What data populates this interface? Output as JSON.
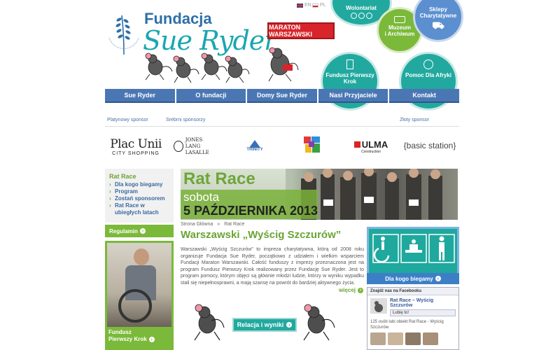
{
  "header": {
    "logo_line1": "Fundacja",
    "logo_line2": "Sue Ryder",
    "marathon_logo": "MARATON WARSZAWSKI",
    "lang_en": "EN",
    "lang_pl": "PL",
    "colors": {
      "blue": "#4a77b4",
      "green": "#7bb93a",
      "teal": "#22a99f"
    }
  },
  "circles": {
    "volunteer": "Wolontariat",
    "museum_line1": "Muzeum",
    "museum_line2": "i Archiwum",
    "shops_line1": "Sklepy",
    "shops_line2": "Charytatywne",
    "fund": "Fundusz Pierwszy Krok",
    "africa": "Pomoc Dla Afryki"
  },
  "nav": {
    "items": [
      "Sue Ryder",
      "O fundacji",
      "Domy Sue Ryder",
      "Nasi Przyjaciele",
      "Kontakt"
    ]
  },
  "sponsors": {
    "platinum_label": "Platynowy sponsor",
    "silver_label": "Srebrni sponsorzy",
    "gold_label": "Złoty sponsor",
    "logo1_line1": "Plac Unii",
    "logo1_line2": "CITY SHOPPING",
    "logo2_line1": "JONES LANG",
    "logo2_line2": "LASALLE",
    "logo3": "TRINITY",
    "logo5": "ULMA",
    "logo5_sub": "Construction",
    "logo6": "{basic station}"
  },
  "sidebar": {
    "title": "Rat Race",
    "links": [
      "Dla kogo biegamy",
      "Program",
      "Zostań sponsorem",
      "Rat Race w ubiegłych latach"
    ],
    "regulamin": "Regulamin",
    "fund_line1": "Fundusz",
    "fund_line2": "Pierwszy Krok"
  },
  "banner": {
    "title": "Rat Race",
    "date_line1": "sobota",
    "date_line2": "5 PAŹDZIERNIKA 2013"
  },
  "breadcrumb": [
    "Strona Główna",
    "»",
    "Rat Race"
  ],
  "main": {
    "title": "Warszawski „Wyścig Szczurów”",
    "text": "Warszawski „Wyścig Szczurów” to impreza charytatywna, którą od 2008 roku organizuje Fundacja Sue Ryder, początkowo z udziałem i wielkim wsparciem Fundacji Maraton Warszawski. Całość funduszy z imprezy przeznaczona jest na program Fundusz Pierwszy Krok realizowany przez Fundację Sue Ryder. Jest to program pomocy, którym objęci są głównie młodzi ludzie, którzy w wyniku wypadku stali się niepełnosprawni, a mają szansę na powrót do bardziej aktywnego życia.",
    "more": "więcej",
    "results_button": "Relacja i wyniki"
  },
  "right": {
    "who_label": "Dla kogo biegamy"
  },
  "facebook": {
    "header": "Znajdź nas na Facebooku",
    "page_name": "Rat Race – Wyścig Szczurów",
    "like": "Lubię to!",
    "count_text": "125 osób lubi obiekt Rat Race - Wyścig Szczurów."
  }
}
